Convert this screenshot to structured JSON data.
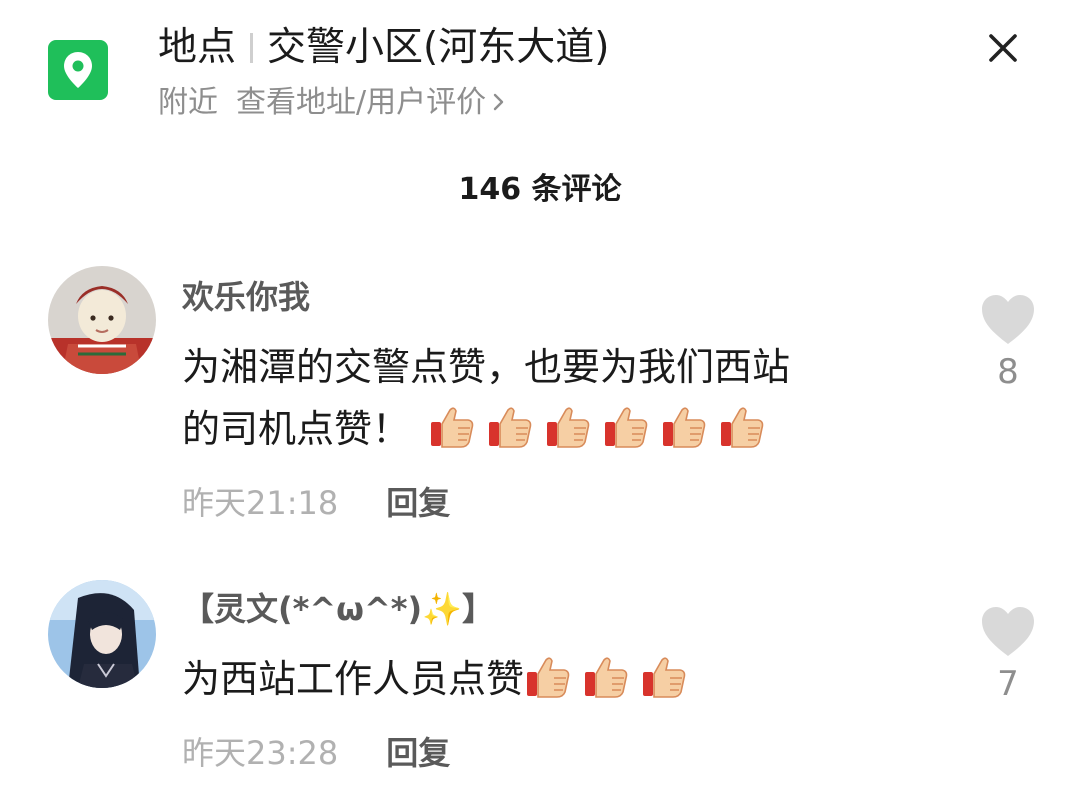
{
  "header": {
    "prefix": "地点",
    "place": "交警小区(河东大道)",
    "nearby": "附近",
    "link": "查看地址/用户评价"
  },
  "comments_count": "146 条评论",
  "comments": [
    {
      "user": "欢乐你我",
      "text_line1": "为湘潭的交警点赞，也要为我们西站",
      "text_line2": "的司机点赞！",
      "emoji_count": 6,
      "time": "昨天21:18",
      "reply": "回复",
      "likes": "8"
    },
    {
      "user": "【灵文(*^ω^*)✨】",
      "text_line1": "为西站工作人员点赞",
      "emoji_count": 3,
      "time": "昨天23:28",
      "reply": "回复",
      "likes": "7"
    }
  ],
  "colors": {
    "accent": "#1fbf5a",
    "text": "#1b1b1b",
    "muted": "#8e8e8e",
    "heart": "#d9d9d9"
  },
  "icons": [
    "location-pin-icon",
    "close-icon",
    "chevron-right-icon",
    "heart-icon",
    "thumbs-up-emoji"
  ]
}
